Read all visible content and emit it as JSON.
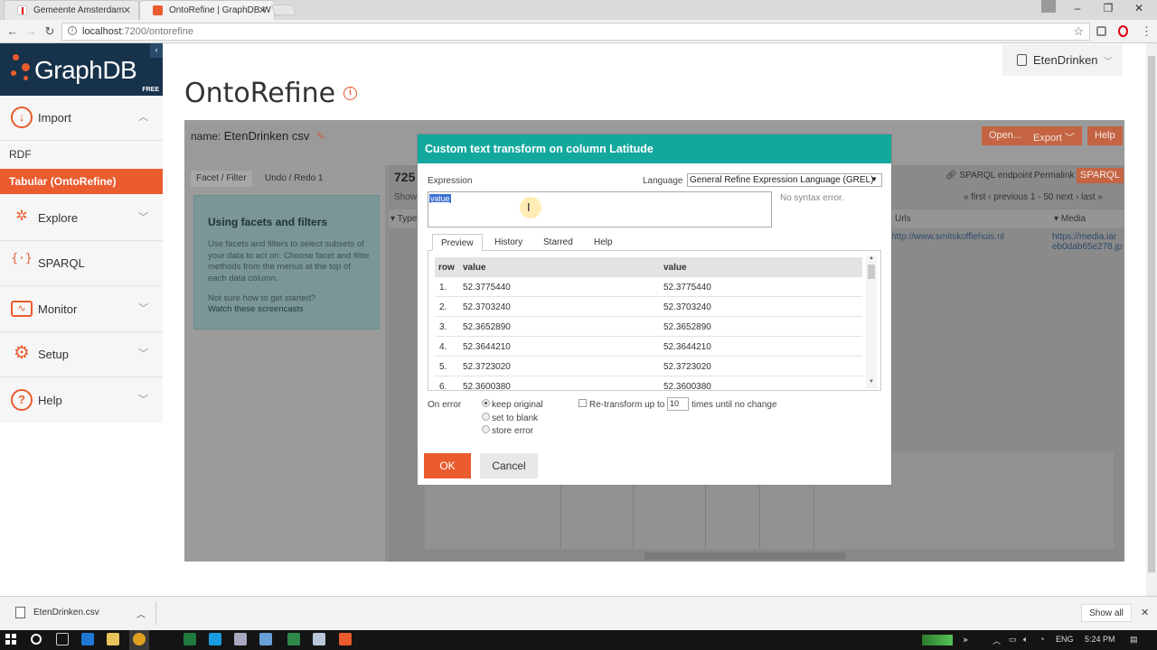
{
  "browser": {
    "tabs": [
      {
        "title": "Gemeente Amsterdam",
        "icon": "amsterdam-favicon",
        "active": false
      },
      {
        "title": "OntoRefine | GraphDB W",
        "icon": "graphdb-favicon",
        "active": true
      }
    ],
    "url_host": "localhost",
    "url_rest": ":7200/ontorefine",
    "window_buttons": [
      "–",
      "❐",
      "✕"
    ]
  },
  "sidebar": {
    "logo": "GraphDB",
    "edition": "FREE",
    "items": [
      {
        "label": "Import",
        "icon": "import-icon",
        "expanded": true
      },
      {
        "label": "Explore",
        "icon": "explore-icon"
      },
      {
        "label": "SPARQL",
        "icon": "sparql-icon"
      },
      {
        "label": "Monitor",
        "icon": "monitor-icon"
      },
      {
        "label": "Setup",
        "icon": "setup-icon"
      },
      {
        "label": "Help",
        "icon": "help-icon"
      }
    ],
    "import_sub": {
      "rdf": "RDF",
      "tabular": "Tabular (OntoRefine)"
    }
  },
  "header": {
    "title": "OntoRefine",
    "repository": "EtenDrinken"
  },
  "project": {
    "name_label": "name:",
    "name": "EtenDrinken csv",
    "buttons": [
      "Open...",
      "Export",
      "Help"
    ],
    "left_tabs": [
      "Facet / Filter",
      "Undo / Redo 1"
    ],
    "facet_help": {
      "title": "Using facets and filters",
      "body1": "Use facets and filters to select subsets of your data to act on. Choose facet and filter methods from the menus at the top of each data column.",
      "body2": "Not sure how to get started?",
      "link": "Watch these screencasts"
    },
    "row_count": "725",
    "show_label": "Show",
    "sparql_endpoint": "SPARQL endpoint",
    "permalink": "Permalink",
    "sparql_button": "SPARQL",
    "pager": "« first  ‹ previous   1 - 50   next ›  last »",
    "columns": [
      "Type",
      "Urls",
      "Media"
    ],
    "cell_url": "http://www.smitskoffiehuis.nl",
    "cell_media": "https://media.iar eb0dab65e278.jp"
  },
  "dialog": {
    "title": "Custom text transform on column Latitude",
    "expression_label": "Expression",
    "language_label": "Language",
    "language_value": "General Refine Expression Language (GREL)",
    "expression": "value",
    "syntax_status": "No syntax error.",
    "tabs": [
      "Preview",
      "History",
      "Starred",
      "Help"
    ],
    "preview_headers": [
      "row",
      "value",
      "value"
    ],
    "preview_rows": [
      {
        "row": "1.",
        "value": "52.3775440",
        "result": "52.3775440"
      },
      {
        "row": "2.",
        "value": "52.3703240",
        "result": "52.3703240"
      },
      {
        "row": "3.",
        "value": "52.3652890",
        "result": "52.3652890"
      },
      {
        "row": "4.",
        "value": "52.3644210",
        "result": "52.3644210"
      },
      {
        "row": "5.",
        "value": "52.3723020",
        "result": "52.3723020"
      },
      {
        "row": "6.",
        "value": "52.3600380",
        "result": "52.3600380"
      }
    ],
    "on_error_label": "On error",
    "on_error_options": [
      "keep original",
      "set to blank",
      "store error"
    ],
    "on_error_selected": "keep original",
    "retransform_label": "Re-transform up to",
    "retransform_value": "10",
    "retransform_suffix": "times until no change",
    "ok": "OK",
    "cancel": "Cancel"
  },
  "downloads": {
    "file": "EtenDrinken.csv",
    "show_all": "Show all"
  },
  "taskbar": {
    "lang": "ENG",
    "time": "5:24 PM"
  },
  "colors": {
    "accent": "#ea5b2e",
    "dialog_header": "#13a89e",
    "logo_bg": "#17324b"
  }
}
